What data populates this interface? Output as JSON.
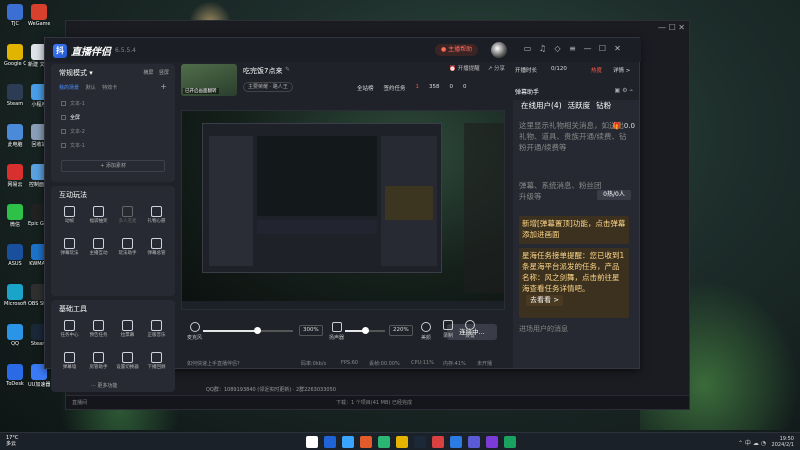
{
  "desktop": {
    "icons": [
      {
        "label": "TJC",
        "color": "#3b6fd1"
      },
      {
        "label": "WeGame",
        "color": "#d8402e"
      },
      {
        "label": "Google Chrome",
        "color": "#e1b400"
      },
      {
        "label": "新建 文本文档",
        "color": "#dfe3ea"
      },
      {
        "label": "Steam",
        "color": "#2d3c55"
      },
      {
        "label": "小程序",
        "color": "#4a9de8"
      },
      {
        "label": "此电脑",
        "color": "#4b8ad8"
      },
      {
        "label": "回收站",
        "color": "#8aa0b8"
      },
      {
        "label": "网易云",
        "color": "#d8302e"
      },
      {
        "label": "控制面板",
        "color": "#5aa2e0"
      },
      {
        "label": "微信",
        "color": "#2dc148"
      },
      {
        "label": "Epic Games",
        "color": "#222222"
      },
      {
        "label": "ASUS",
        "color": "#1a4f9e"
      },
      {
        "label": "KWMAN",
        "color": "#1d73c9"
      },
      {
        "label": "Microsoft Edge",
        "color": "#1ba4c9"
      },
      {
        "label": "OBS Studio",
        "color": "#303030"
      },
      {
        "label": "QQ",
        "color": "#2a94e6"
      },
      {
        "label": "Steam",
        "color": "#1b2838"
      },
      {
        "label": "ToDesk",
        "color": "#2a6be5"
      },
      {
        "label": "UU加速器",
        "color": "#3a7bf5"
      }
    ]
  },
  "background_window": {
    "status_left": "直播间",
    "status_mid": "下载：1 个项目(41 MB) 已经完成",
    "info_line": "QQ群：1089193840 (邻近实时更新)  ·  2群2263033050"
  },
  "app": {
    "name": "直播伴侣",
    "version": "6.5.5.4",
    "logo_char": "抖",
    "start_live_label": "主播帮助",
    "title_icons": [
      "message-icon",
      "headset-icon",
      "gift-icon",
      "menu-icon",
      "minimize-icon",
      "maximize-icon",
      "close-icon"
    ]
  },
  "mode_card": {
    "title": "常规模式 ▾",
    "links": [
      "横屏",
      "竖屏"
    ],
    "scene_tabs": [
      "我的场景",
      "默认",
      "特效卡"
    ],
    "sources": [
      {
        "label": "文本-1",
        "on": false
      },
      {
        "label": "全屏",
        "on": true
      },
      {
        "label": "文本-2",
        "on": false
      },
      {
        "label": "文本-1",
        "on": false
      }
    ],
    "add_material": "+ 添加素材"
  },
  "interact": {
    "title": "互动玩法",
    "items": [
      {
        "label": "动帧",
        "icon": "frame-icon",
        "dim": false
      },
      {
        "label": "福袋抽奖",
        "icon": "lucky-bag-icon",
        "dim": false
      },
      {
        "label": "多人连麦",
        "icon": "multi-link-icon",
        "dim": true
      },
      {
        "label": "礼物心愿",
        "icon": "gift-wish-icon",
        "dim": false
      },
      {
        "label": "弹幕玩法",
        "icon": "danmu-game-icon",
        "dim": false
      },
      {
        "label": "主播互动",
        "icon": "pk-icon",
        "dim": false
      },
      {
        "label": "玩法助手",
        "icon": "helper-icon",
        "dim": false
      },
      {
        "label": "弹幕总管",
        "icon": "admin-icon",
        "dim": false
      }
    ]
  },
  "tools": {
    "title": "基础工具",
    "items": [
      {
        "label": "任务中心",
        "icon": "task-icon",
        "dim": false
      },
      {
        "label": "预告任务",
        "icon": "ad-icon",
        "dim": false
      },
      {
        "label": "拉票幕",
        "icon": "vote-icon",
        "dim": false
      },
      {
        "label": "正版音乐",
        "icon": "download-icon",
        "dim": false
      },
      {
        "label": "弹幕墙",
        "icon": "danmu-wall-icon",
        "dim": false
      },
      {
        "label": "房管助手",
        "icon": "admin-helper-icon",
        "dim": false
      },
      {
        "label": "设置切换器",
        "icon": "switch-icon",
        "dim": false
      },
      {
        "label": "下播回顾",
        "icon": "review-icon",
        "dim": false
      }
    ],
    "more_label": "··· 更多功能"
  },
  "room": {
    "title": "吃完饭7点来",
    "category": "主要荣耀 · 路人王",
    "thumb_caption": "已开启画面翻转",
    "right_links": [
      "开播提醒",
      "分享"
    ],
    "meta": [
      {
        "label": "全站榜",
        "cls": "stat"
      },
      {
        "label": "签约任务",
        "cls": "stat"
      },
      {
        "label": "1",
        "cls": "red"
      },
      {
        "label": "358",
        "cls": "stat"
      },
      {
        "label": "0",
        "cls": "stat"
      },
      {
        "label": "0",
        "cls": "stat"
      }
    ]
  },
  "controls": {
    "mic_label": "麦克风",
    "mic_pct": "300%",
    "mic_level": 0.6,
    "speaker_label": "扬声器",
    "speaker_pct": "220%",
    "speaker_level": 0.5,
    "beauty_label": "美颜",
    "record_label": "录制",
    "settings_label": "设置",
    "connect_label": "连接中..."
  },
  "status": {
    "help": "如何快速上手直播伴侣?",
    "bitrate": "码率:0kb/s",
    "fps": "FPS:60",
    "drop": "丢帧:00.00%",
    "cpu": "CPU:11%",
    "mem": "内存:41%",
    "state": "未开播"
  },
  "right_panel": {
    "rank_label": "开播时长",
    "rank_value": "0/120",
    "hot_label": "热度",
    "detail_label": "详情 >",
    "danmu_title": "弹幕助手",
    "tabs": [
      "在线用户(4)",
      "活跃度",
      "钻粉"
    ],
    "gift_text": "这里显示礼物相关消息，如送出礼物、道具、贵族开通/续费、钻粉开通/续费等",
    "gift_value": "0.0",
    "sys_text": "弹幕、系统消息、粉丝团升级等",
    "pop_text": "0热/0人",
    "tip1": "新增[弹幕置顶]功能，点击弹幕添加进画面",
    "tip2": "星海任务接单提醒：您已收到1条星海平台派发的任务，产品名称：风之剑舞，点击前往星海查看任务详情吧。",
    "go_label": "去看看 >",
    "foot_text": "进场用户的消息"
  },
  "taskbar": {
    "weather_temp": "17°C",
    "weather_desc": "多云",
    "apps": [
      "#ffffff",
      "#1f63d6",
      "#3aa4ff",
      "#e35b2b",
      "#2bb673",
      "#e6b400",
      "#1b2838",
      "#d94040",
      "#2c7be5",
      "#5b5bd6",
      "#7a3bd6",
      "#1aa260"
    ],
    "time": "19:50",
    "date": "2024/2/1"
  }
}
